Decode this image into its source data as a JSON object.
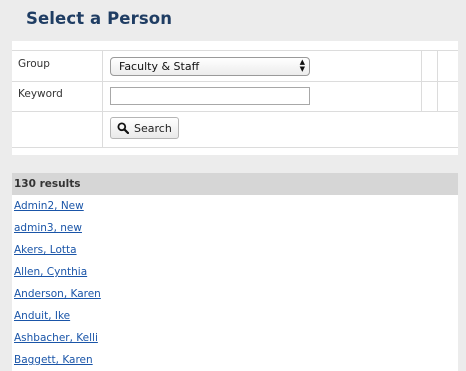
{
  "page": {
    "title": "Select a Person"
  },
  "form": {
    "group": {
      "label": "Group",
      "selected": "Faculty & Staff"
    },
    "keyword": {
      "label": "Keyword",
      "value": "",
      "placeholder": ""
    },
    "search_button": {
      "label": "Search",
      "icon": "search-icon"
    }
  },
  "results": {
    "count_text": "130 results",
    "items": [
      "Admin2, New",
      "admin3, new",
      "Akers, Lotta",
      "Allen, Cynthia",
      "Anderson, Karen",
      "Anduit, Ike",
      "Ashbacher, Kelli",
      "Baggett, Karen"
    ]
  },
  "colors": {
    "title": "#1f3d63",
    "link": "#1a55a8",
    "header_bar": "#d6d6d6",
    "background": "#ececec"
  }
}
